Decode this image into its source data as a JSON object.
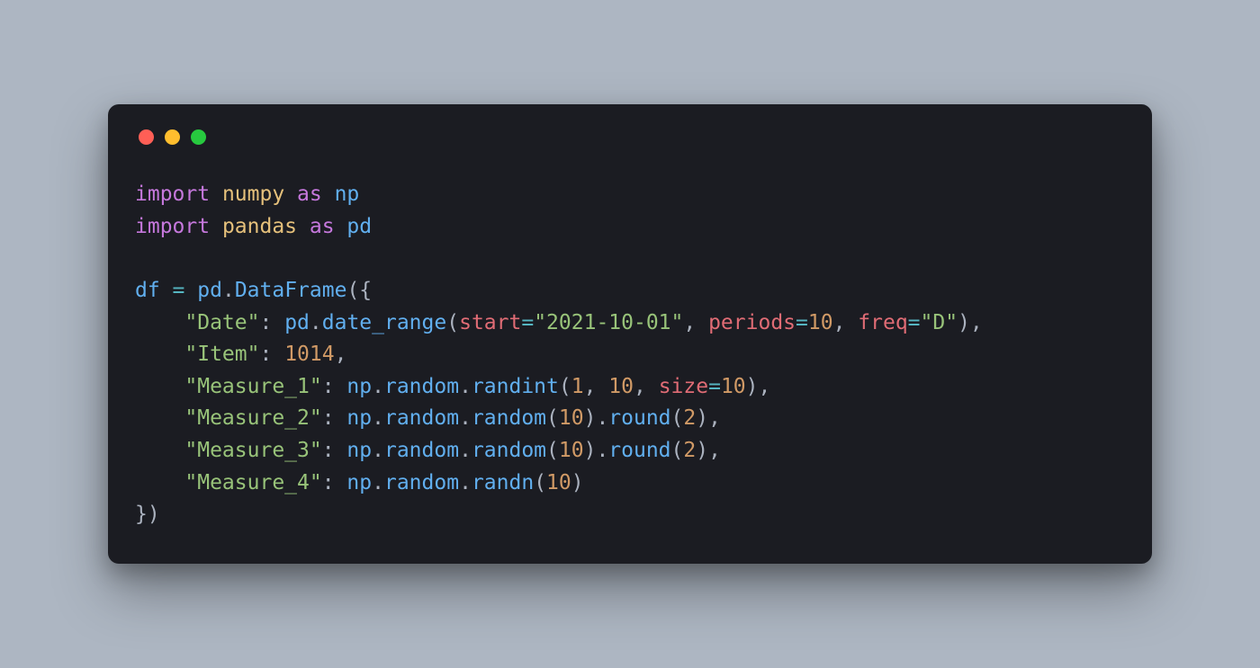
{
  "window": {
    "traffic_lights": [
      "red",
      "yellow",
      "green"
    ]
  },
  "colors": {
    "background_page": "#adb6c2",
    "background_window": "#1b1c22",
    "keyword": "#c678dd",
    "module": "#e5c07b",
    "alias": "#61afef",
    "operator": "#56b6c2",
    "attribute": "#61afef",
    "string": "#98c379",
    "number": "#d19a66",
    "param_name": "#e06c75",
    "punctuation": "#abb2bf",
    "default_text": "#d5d8df",
    "dot_red": "#ff5f56",
    "dot_yellow": "#ffbd2e",
    "dot_green": "#27c93f"
  },
  "code": {
    "lines": [
      [
        {
          "t": "import ",
          "c": "kw"
        },
        {
          "t": "numpy ",
          "c": "mod"
        },
        {
          "t": "as ",
          "c": "kw"
        },
        {
          "t": "np",
          "c": "alias"
        }
      ],
      [
        {
          "t": "import ",
          "c": "kw"
        },
        {
          "t": "pandas ",
          "c": "mod"
        },
        {
          "t": "as ",
          "c": "kw"
        },
        {
          "t": "pd",
          "c": "alias"
        }
      ],
      [
        {
          "t": "",
          "c": "punct"
        }
      ],
      [
        {
          "t": "df ",
          "c": "alias"
        },
        {
          "t": "= ",
          "c": "op"
        },
        {
          "t": "pd",
          "c": "alias"
        },
        {
          "t": ".",
          "c": "punct"
        },
        {
          "t": "DataFrame",
          "c": "attr"
        },
        {
          "t": "({",
          "c": "punct"
        }
      ],
      [
        {
          "t": "    ",
          "c": "punct"
        },
        {
          "t": "\"Date\"",
          "c": "str"
        },
        {
          "t": ": ",
          "c": "punct"
        },
        {
          "t": "pd",
          "c": "alias"
        },
        {
          "t": ".",
          "c": "punct"
        },
        {
          "t": "date_range",
          "c": "attr"
        },
        {
          "t": "(",
          "c": "punct"
        },
        {
          "t": "start",
          "c": "param"
        },
        {
          "t": "=",
          "c": "op"
        },
        {
          "t": "\"2021-10-01\"",
          "c": "str"
        },
        {
          "t": ", ",
          "c": "punct"
        },
        {
          "t": "periods",
          "c": "param"
        },
        {
          "t": "=",
          "c": "op"
        },
        {
          "t": "10",
          "c": "num"
        },
        {
          "t": ", ",
          "c": "punct"
        },
        {
          "t": "freq",
          "c": "param"
        },
        {
          "t": "=",
          "c": "op"
        },
        {
          "t": "\"D\"",
          "c": "str"
        },
        {
          "t": "),",
          "c": "punct"
        }
      ],
      [
        {
          "t": "    ",
          "c": "punct"
        },
        {
          "t": "\"Item\"",
          "c": "str"
        },
        {
          "t": ": ",
          "c": "punct"
        },
        {
          "t": "1014",
          "c": "num"
        },
        {
          "t": ",",
          "c": "punct"
        }
      ],
      [
        {
          "t": "    ",
          "c": "punct"
        },
        {
          "t": "\"Measure_1\"",
          "c": "str"
        },
        {
          "t": ": ",
          "c": "punct"
        },
        {
          "t": "np",
          "c": "alias"
        },
        {
          "t": ".",
          "c": "punct"
        },
        {
          "t": "random",
          "c": "attr"
        },
        {
          "t": ".",
          "c": "punct"
        },
        {
          "t": "randint",
          "c": "attr"
        },
        {
          "t": "(",
          "c": "punct"
        },
        {
          "t": "1",
          "c": "num"
        },
        {
          "t": ", ",
          "c": "punct"
        },
        {
          "t": "10",
          "c": "num"
        },
        {
          "t": ", ",
          "c": "punct"
        },
        {
          "t": "size",
          "c": "param"
        },
        {
          "t": "=",
          "c": "op"
        },
        {
          "t": "10",
          "c": "num"
        },
        {
          "t": "),",
          "c": "punct"
        }
      ],
      [
        {
          "t": "    ",
          "c": "punct"
        },
        {
          "t": "\"Measure_2\"",
          "c": "str"
        },
        {
          "t": ": ",
          "c": "punct"
        },
        {
          "t": "np",
          "c": "alias"
        },
        {
          "t": ".",
          "c": "punct"
        },
        {
          "t": "random",
          "c": "attr"
        },
        {
          "t": ".",
          "c": "punct"
        },
        {
          "t": "random",
          "c": "attr"
        },
        {
          "t": "(",
          "c": "punct"
        },
        {
          "t": "10",
          "c": "num"
        },
        {
          "t": ").",
          "c": "punct"
        },
        {
          "t": "round",
          "c": "attr"
        },
        {
          "t": "(",
          "c": "punct"
        },
        {
          "t": "2",
          "c": "num"
        },
        {
          "t": "),",
          "c": "punct"
        }
      ],
      [
        {
          "t": "    ",
          "c": "punct"
        },
        {
          "t": "\"Measure_3\"",
          "c": "str"
        },
        {
          "t": ": ",
          "c": "punct"
        },
        {
          "t": "np",
          "c": "alias"
        },
        {
          "t": ".",
          "c": "punct"
        },
        {
          "t": "random",
          "c": "attr"
        },
        {
          "t": ".",
          "c": "punct"
        },
        {
          "t": "random",
          "c": "attr"
        },
        {
          "t": "(",
          "c": "punct"
        },
        {
          "t": "10",
          "c": "num"
        },
        {
          "t": ").",
          "c": "punct"
        },
        {
          "t": "round",
          "c": "attr"
        },
        {
          "t": "(",
          "c": "punct"
        },
        {
          "t": "2",
          "c": "num"
        },
        {
          "t": "),",
          "c": "punct"
        }
      ],
      [
        {
          "t": "    ",
          "c": "punct"
        },
        {
          "t": "\"Measure_4\"",
          "c": "str"
        },
        {
          "t": ": ",
          "c": "punct"
        },
        {
          "t": "np",
          "c": "alias"
        },
        {
          "t": ".",
          "c": "punct"
        },
        {
          "t": "random",
          "c": "attr"
        },
        {
          "t": ".",
          "c": "punct"
        },
        {
          "t": "randn",
          "c": "attr"
        },
        {
          "t": "(",
          "c": "punct"
        },
        {
          "t": "10",
          "c": "num"
        },
        {
          "t": ")",
          "c": "punct"
        }
      ],
      [
        {
          "t": "})",
          "c": "punct"
        }
      ]
    ]
  }
}
